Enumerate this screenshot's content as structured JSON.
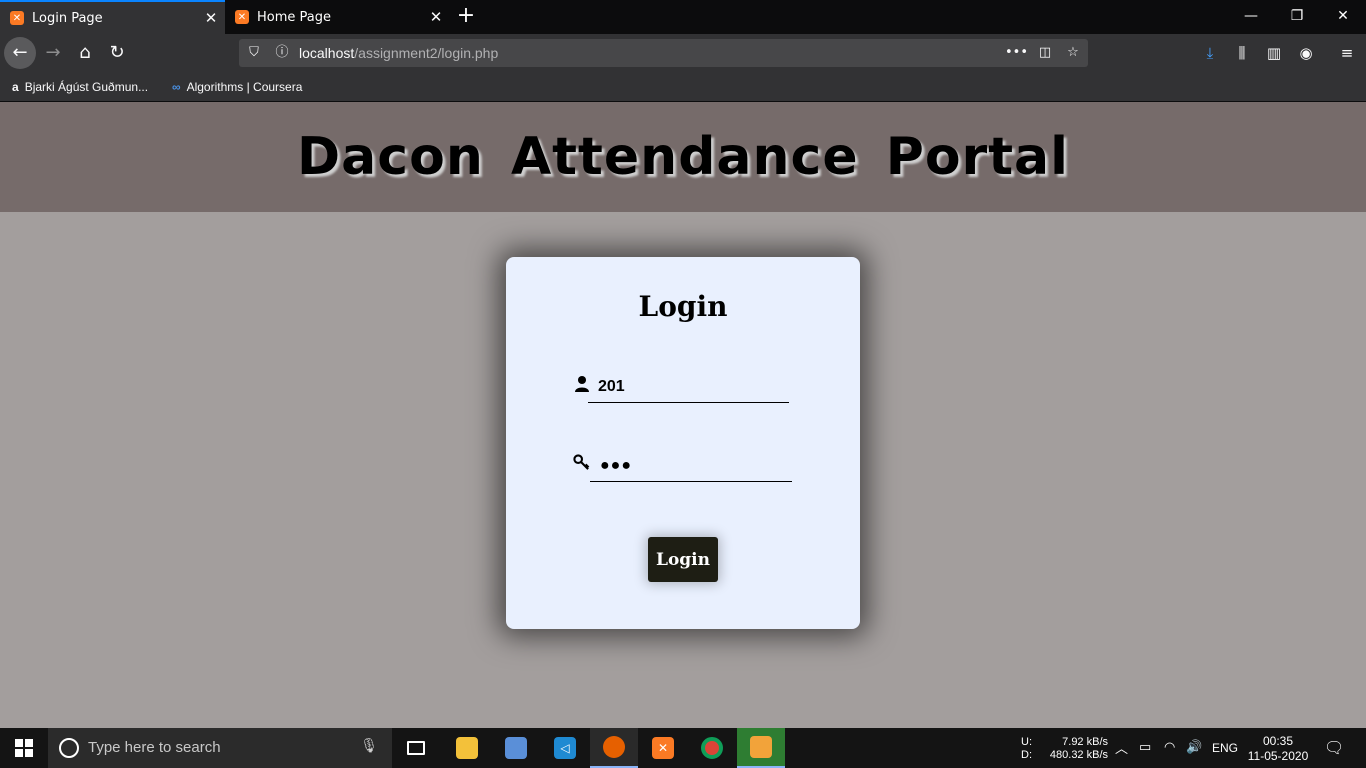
{
  "browser": {
    "tabs": [
      {
        "label": "Login Page",
        "active": true
      },
      {
        "label": "Home Page",
        "active": false
      }
    ],
    "url": {
      "host": "localhost",
      "path": "/assignment2/login.php"
    },
    "bookmarks": [
      {
        "label": "Bjarki Ágúst Guðmun...",
        "icon": "amazon-a-icon"
      },
      {
        "label": "Algorithms | Coursera",
        "icon": "coursera-icon"
      }
    ]
  },
  "page": {
    "header_title": "Dacon Attendance Portal",
    "card_title": "Login",
    "username_value": "201",
    "password_value": "●●●",
    "login_button": "Login"
  },
  "taskbar": {
    "search_placeholder": "Type here to search",
    "net_up_label": "U:",
    "net_down_label": "D:",
    "net_up": "7.92 kB/s",
    "net_down": "480.32 kB/s",
    "language": "ENG",
    "time": "00:35",
    "date": "11-05-2020"
  },
  "colors": {
    "header_bg": "#766b6a",
    "body_bg": "#a39e9d",
    "card_bg": "#e9f0fe",
    "button_bg": "#1e1e14",
    "tab_accent": "#0a84ff"
  }
}
